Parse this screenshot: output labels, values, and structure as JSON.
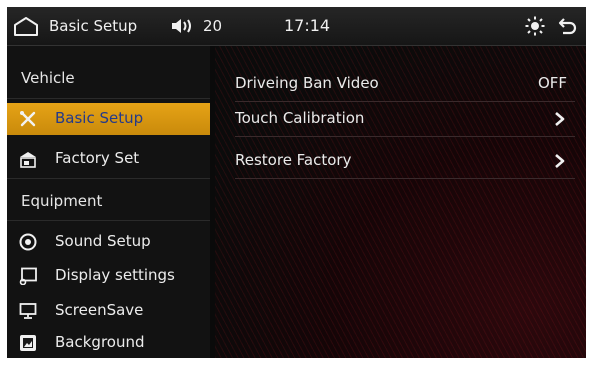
{
  "status_bar": {
    "title": "Basic Setup",
    "volume": "20",
    "time": "17:14"
  },
  "sidebar": {
    "sections": [
      {
        "label": "Vehicle"
      },
      {
        "label": "Equipment"
      }
    ],
    "items": [
      {
        "label": "Basic Setup",
        "icon": "tools-icon",
        "active": true
      },
      {
        "label": "Factory Set",
        "icon": "factory-icon",
        "active": false
      },
      {
        "label": "Sound Setup",
        "icon": "sound-icon",
        "active": false
      },
      {
        "label": "Display settings",
        "icon": "display-icon",
        "active": false
      },
      {
        "label": "ScreenSave",
        "icon": "monitor-icon",
        "active": false
      },
      {
        "label": "Background",
        "icon": "background-icon",
        "active": false
      }
    ]
  },
  "main": {
    "settings": [
      {
        "label": "Driveing Ban Video",
        "value": "OFF"
      },
      {
        "label": "Touch Calibration"
      },
      {
        "label": "Restore Factory"
      }
    ]
  },
  "colors": {
    "active_bg": "#d9960f",
    "active_text": "#243a8a",
    "accent_red": "#a0192a"
  }
}
